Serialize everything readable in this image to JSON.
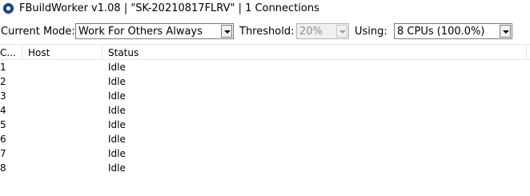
{
  "window": {
    "title": "FBuildWorker v1.08 | \"SK-20210817FLRV\" | 1 Connections",
    "icon": "fastbuild-app-icon"
  },
  "toolbar": {
    "mode_label": "Current Mode:",
    "mode_value": "Work For Others Always",
    "threshold_label": "Threshold:",
    "threshold_value": "20%",
    "using_label": "Using:",
    "using_value": "8 CPUs (100.0%)"
  },
  "list": {
    "columns": [
      "C...",
      "Host",
      "Status"
    ],
    "rows": [
      {
        "cpu": "1",
        "host": "",
        "status": "Idle"
      },
      {
        "cpu": "2",
        "host": "",
        "status": "Idle"
      },
      {
        "cpu": "3",
        "host": "",
        "status": "Idle"
      },
      {
        "cpu": "4",
        "host": "",
        "status": "Idle"
      },
      {
        "cpu": "5",
        "host": "",
        "status": "Idle"
      },
      {
        "cpu": "6",
        "host": "",
        "status": "Idle"
      },
      {
        "cpu": "7",
        "host": "",
        "status": "Idle"
      },
      {
        "cpu": "8",
        "host": "",
        "status": "Idle"
      }
    ]
  }
}
